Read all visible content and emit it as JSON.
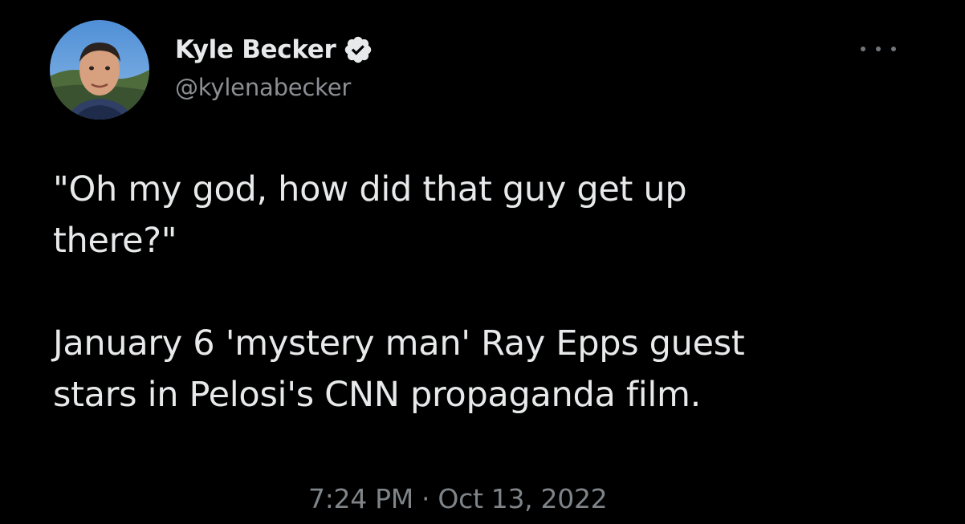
{
  "tweet": {
    "author": {
      "display_name": "Kyle Becker",
      "handle": "@kylenabecker",
      "verified": true,
      "avatar_icon": "profile-photo"
    },
    "more_icon": "more-options-icon",
    "text_paragraphs": [
      "\"Oh my god, how did that guy get up\nthere?\"",
      "January 6 'mystery man' Ray Epps guest\nstars in Pelosi's CNN propaganda film."
    ],
    "timestamp": "7:24 PM · Oct 13, 2022"
  },
  "colors": {
    "background": "#000000",
    "primary_text": "#e7e9ea",
    "secondary_text": "#8b8f93",
    "verified_badge": "#e7e9ea"
  }
}
